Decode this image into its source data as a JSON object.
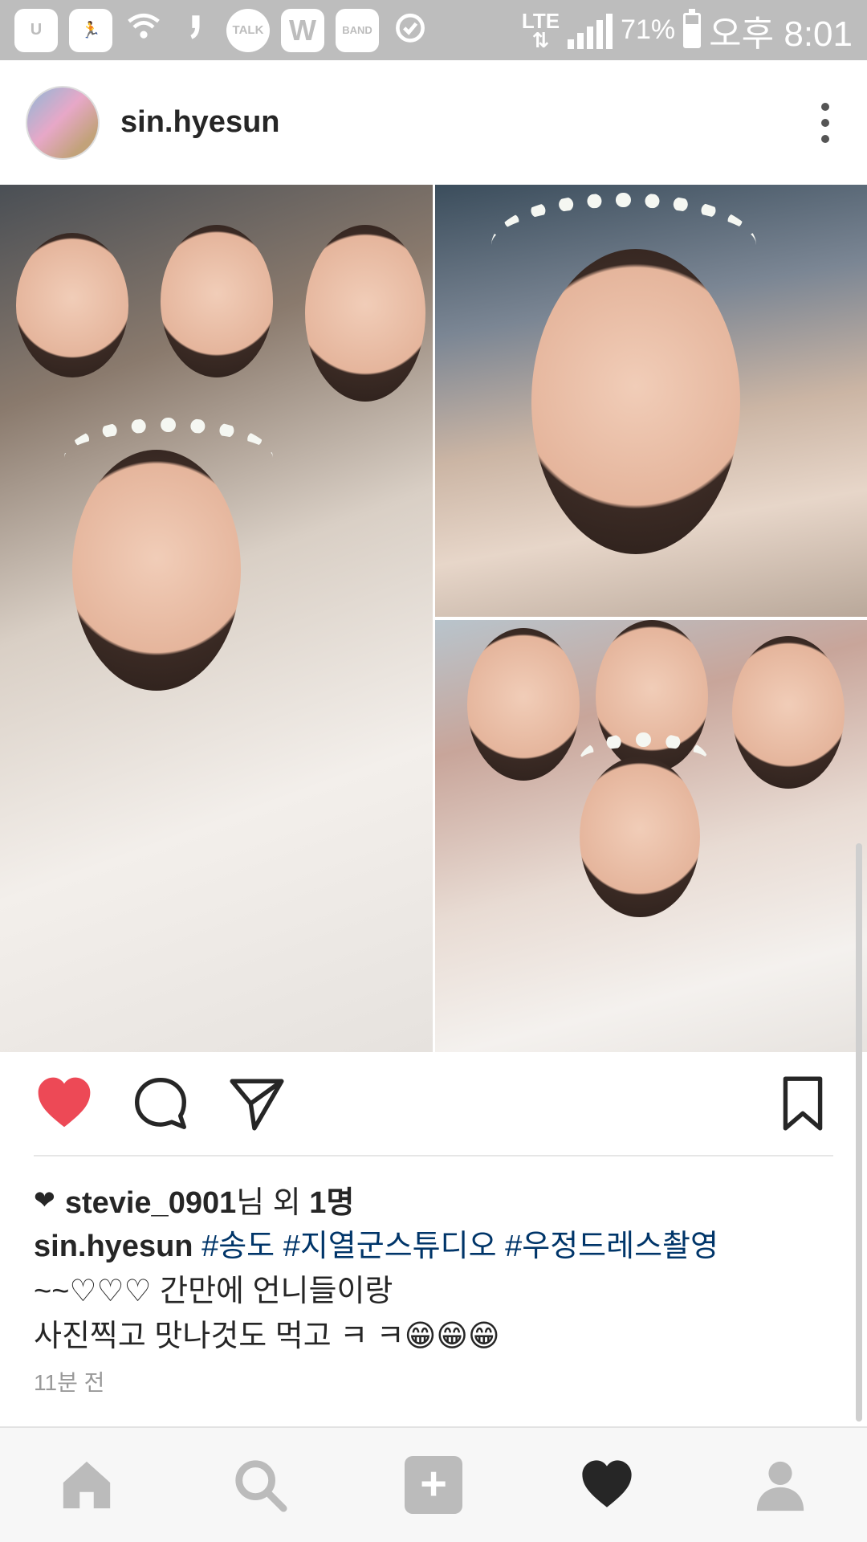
{
  "status_bar": {
    "left_icons": [
      "U",
      "run",
      "wifi-q",
      "comma",
      "TALK",
      "W",
      "BAND",
      "alarm"
    ],
    "network": "LTE",
    "battery_percent": "71%",
    "battery_level": 0.71,
    "time": "오후 8:01"
  },
  "post": {
    "username": "sin.hyesun",
    "likes": {
      "user": "stevie_0901",
      "suffix_pre": "님 외 ",
      "count": "1명"
    },
    "caption": {
      "user": "sin.hyesun",
      "tags": [
        "#송도",
        "#지열군스튜디오",
        "#우정드레스촬영"
      ],
      "line2": "~~♡♡♡ 간만에 언니들이랑",
      "line3": "사진찍고  맛나것도 먹고  ㅋ ㅋ😁😁😁"
    },
    "timestamp": "11분 전"
  },
  "colors": {
    "like_red": "#ed4956",
    "hashtag_blue": "#003569",
    "status_gray": "#bdbdbd"
  },
  "icons": {
    "like": "heart-icon",
    "comment": "comment-icon",
    "share": "send-icon",
    "save": "bookmark-icon",
    "nav": [
      "home-icon",
      "search-icon",
      "add-icon",
      "activity-icon",
      "profile-icon"
    ]
  }
}
